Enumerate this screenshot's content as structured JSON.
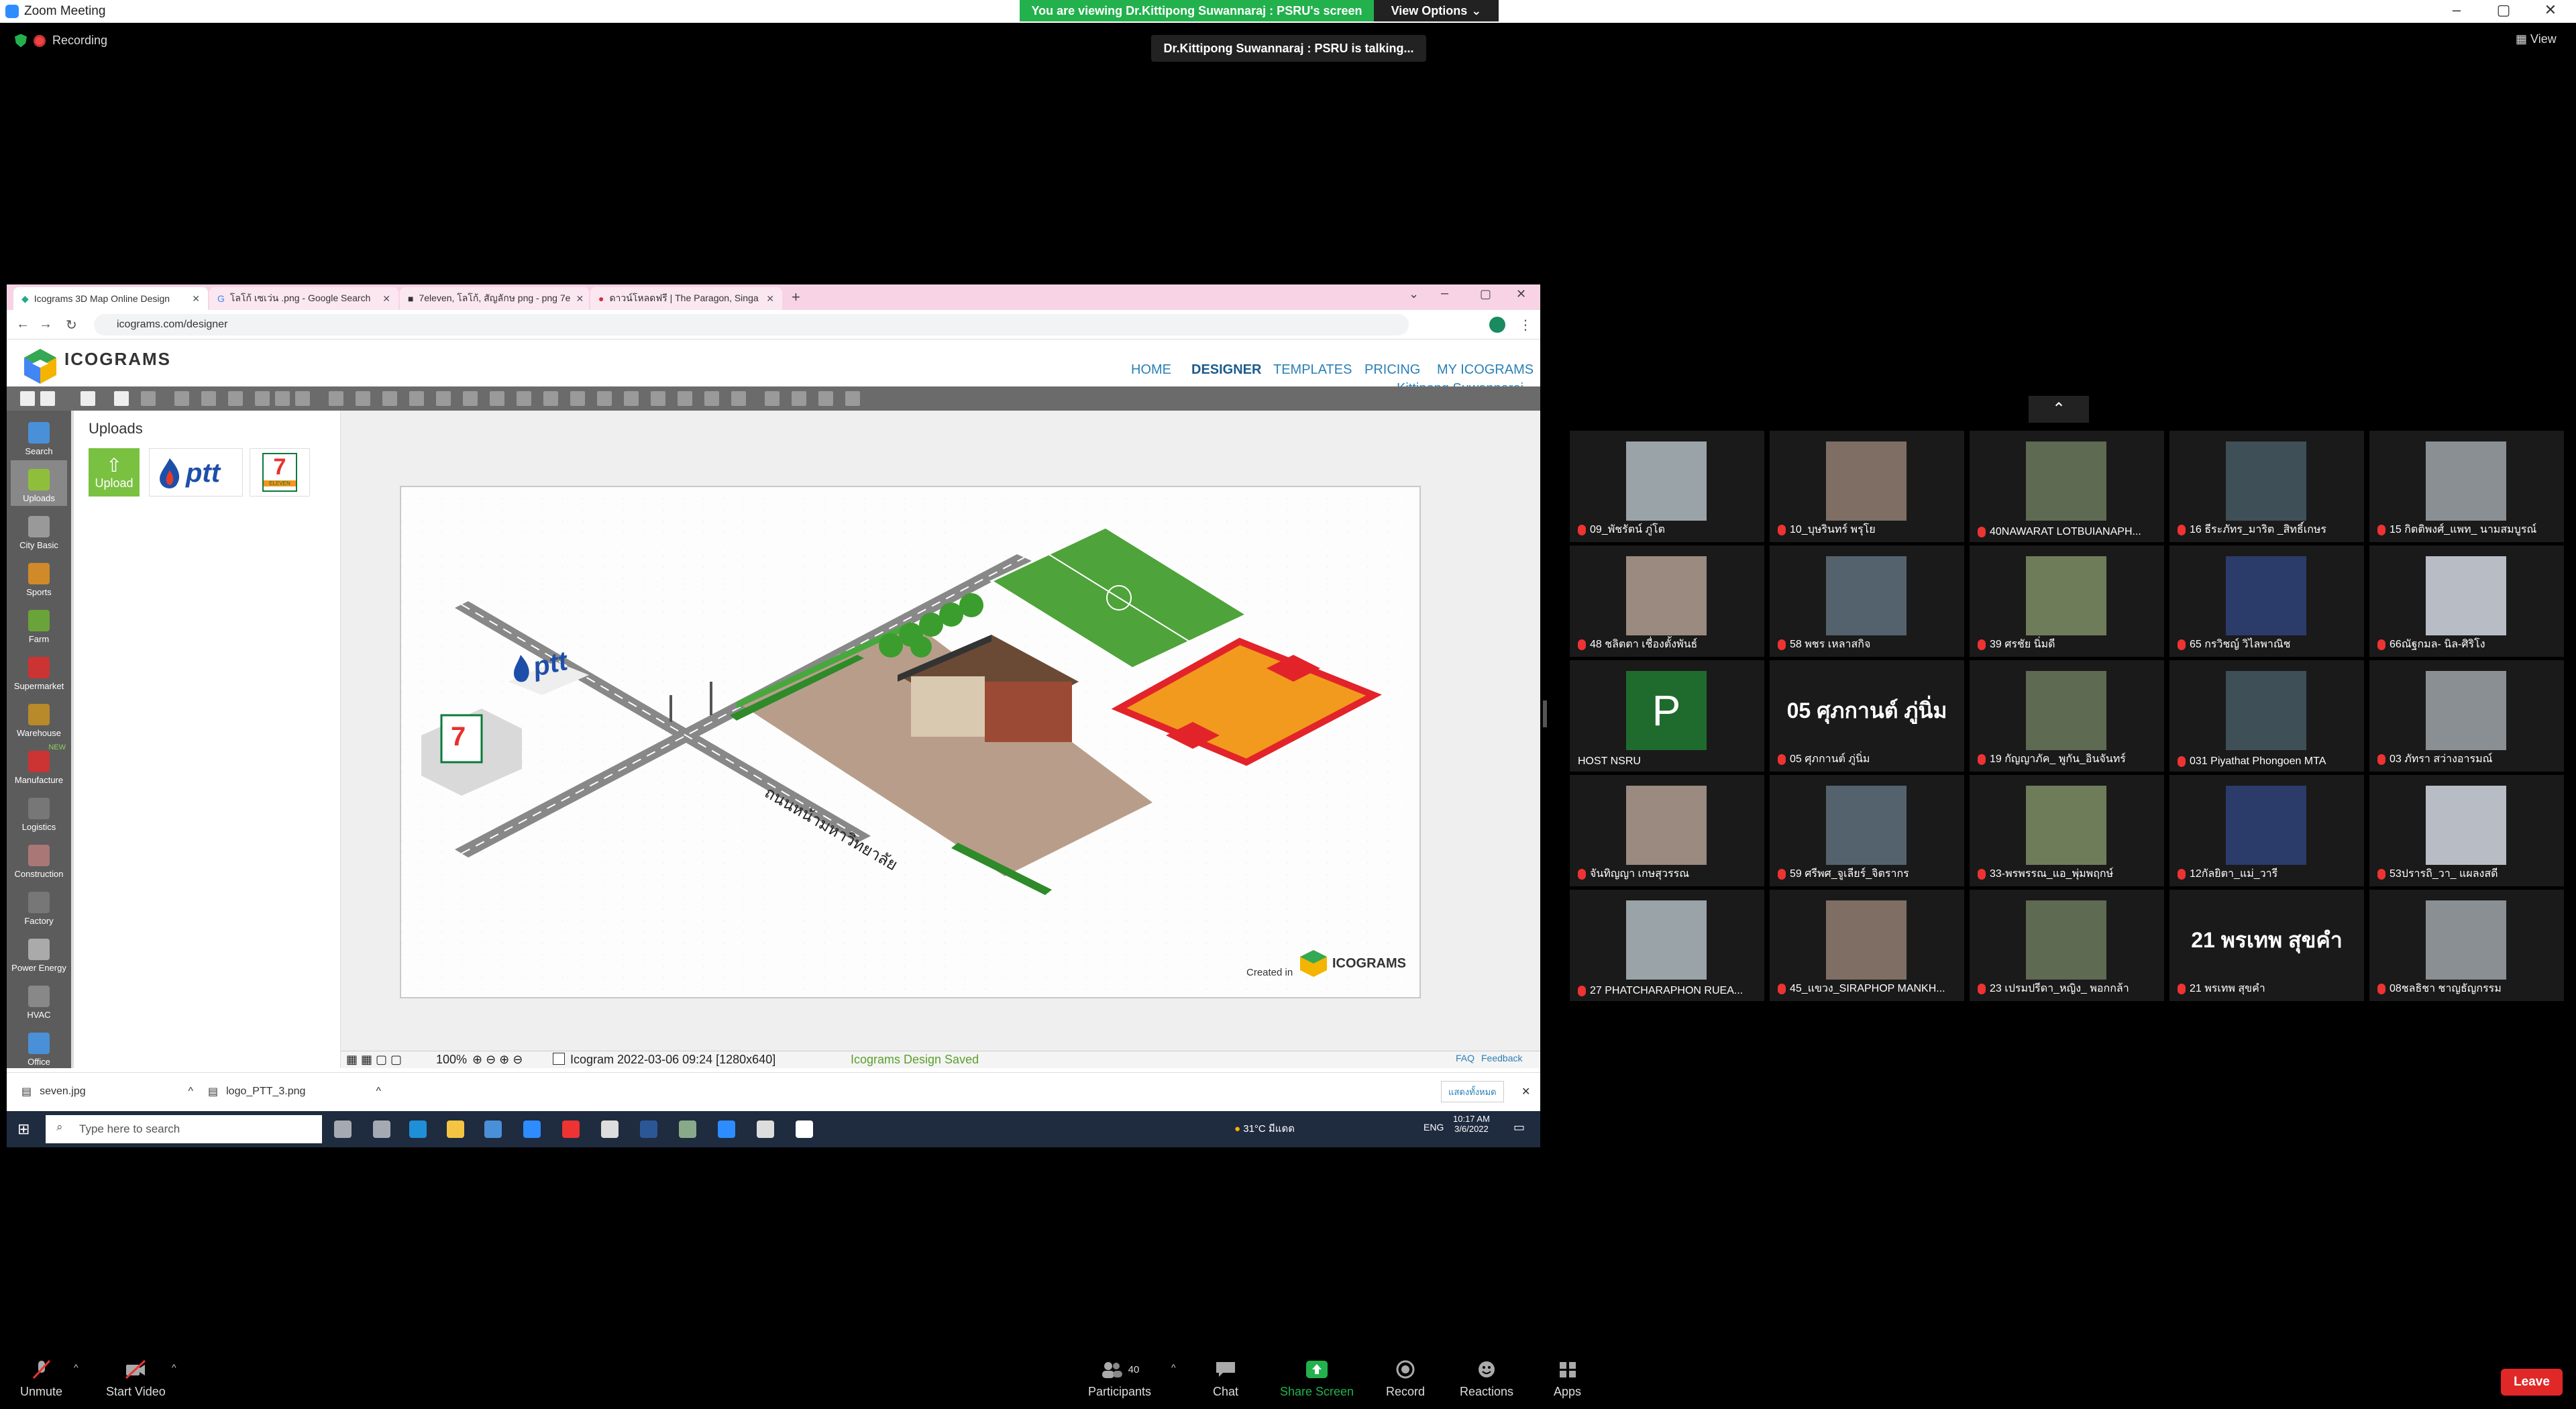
{
  "window": {
    "title": "Zoom Meeting"
  },
  "banner": {
    "text": "You are viewing Dr.Kittipong Suwannaraj : PSRU's screen",
    "view_options": "View Options"
  },
  "recording": {
    "label": "Recording"
  },
  "talking": {
    "text": "Dr.Kittipong Suwannaraj : PSRU is talking..."
  },
  "view_button": {
    "label": "View"
  },
  "browser": {
    "tabs": [
      {
        "label": "Icograms 3D Map Online Design"
      },
      {
        "label": "โลโก้ เซเว่น .png - Google Search"
      },
      {
        "label": "7eleven, โลโก้, สัญลักษ png - png 7e"
      },
      {
        "label": "ดาวน์โหลดฟรี | The Paragon, Singa"
      }
    ],
    "url": "icograms.com/designer"
  },
  "icograms": {
    "logo_text": "ICOGRAMS",
    "menu": [
      "HOME",
      "DESIGNER",
      "TEMPLATES",
      "PRICING",
      "MY ICOGRAMS"
    ],
    "user": "Kittipong Suwannaraj",
    "sidebar": [
      "Search",
      "Uploads",
      "City Basic",
      "Sports",
      "Farm",
      "Supermarket",
      "Warehouse",
      "Manufacture",
      "Logistics",
      "Construction",
      "Factory",
      "Power Energy",
      "HVAC",
      "Office"
    ],
    "new_badge": "NEW",
    "uploads_title": "Uploads",
    "upload_button": "Upload",
    "ptt_text": "ptt",
    "seven_text": "7",
    "seven_sub": "ELEVEN",
    "road_text": "ถนนหน้ามหาวิทยาลัย",
    "created_in": "Created in",
    "status": {
      "zoom": "100%",
      "doc": "Icogram 2022-03-06 09:24 [1280x640]",
      "saved": "Icograms Design Saved",
      "faq": "FAQ",
      "feedback": "Feedback"
    }
  },
  "downloads": [
    {
      "name": "seven.jpg"
    },
    {
      "name": "logo_PTT_3.png"
    }
  ],
  "downloads_show_all": "แสดงทั้งหมด",
  "taskbar": {
    "search_placeholder": "Type here to search",
    "weather": "31°C มีแดด",
    "lang": "ENG",
    "time": "10:17 AM",
    "date": "3/6/2022"
  },
  "participants": [
    {
      "name": "09_พัชรัตน์ ภู่โต"
    },
    {
      "name": "10_บุษรินทร์ พรุโย"
    },
    {
      "name": "40NAWARAT LOTBUIANAPH..."
    },
    {
      "name": "16 ธีระภัทร_มาริต _สิทธิ์เกษร"
    },
    {
      "name": "15 กิตติพงศ์_แพท_ นามสมบูรณ์"
    },
    {
      "name": "48 ชลิตตา เชื่องตั้งพันธ์"
    },
    {
      "name": "58 พชร เหลาสกิจ"
    },
    {
      "name": "39 ศรชัย นิ่มดี"
    },
    {
      "name": "65 กรวิชญ์ วิไลพาณิช"
    },
    {
      "name": "66ณัฐกมล- นิล-ศิริโง"
    },
    {
      "name": "HOST NSRU",
      "letter": "P"
    },
    {
      "name": "05 ศุภกานต์ ภู่นิ่ม",
      "big": "05 ศุภกานต์ ภู่นิ่ม"
    },
    {
      "name": "19 กัญญาภัค_ พูกัน_อินจันทร์"
    },
    {
      "name": "031 Piyathat Phongoen MTA"
    },
    {
      "name": "03 ภัทรา สว่างอารมณ์"
    },
    {
      "name": "จันทิญญา เกษสุวรรณ"
    },
    {
      "name": "59 ศรีพศ_จูเลียร์_จิตรากร"
    },
    {
      "name": "33-พรพรรณ_แอ_พุ่มพฤกษ์"
    },
    {
      "name": "12กัลยิตา_แม่_วารี"
    },
    {
      "name": "53ปรารถิ_วา_ แผลงสดี"
    },
    {
      "name": "27 PHATCHARAPHON RUEA..."
    },
    {
      "name": "45_แขวง_SIRAPHOP MANKH..."
    },
    {
      "name": "23 เปรมปรีดา_หญิง_ พอกกล้า"
    },
    {
      "name": "21 พรเทพ สุขคำ",
      "big": "21 พรเทพ สุขคำ"
    },
    {
      "name": "08ชลธิชา ชาญธัญกรรม"
    }
  ],
  "bottombar": {
    "unmute": "Unmute",
    "start_video": "Start Video",
    "participants": "Participants",
    "participants_count": "40",
    "chat": "Chat",
    "share": "Share Screen",
    "record": "Record",
    "reactions": "Reactions",
    "apps": "Apps",
    "leave": "Leave"
  },
  "colors": {
    "banner": "#23b14d",
    "share": "#23b14d",
    "leave": "#e02828",
    "link": "#2b7fb6",
    "mic_muted": "#e33333"
  }
}
